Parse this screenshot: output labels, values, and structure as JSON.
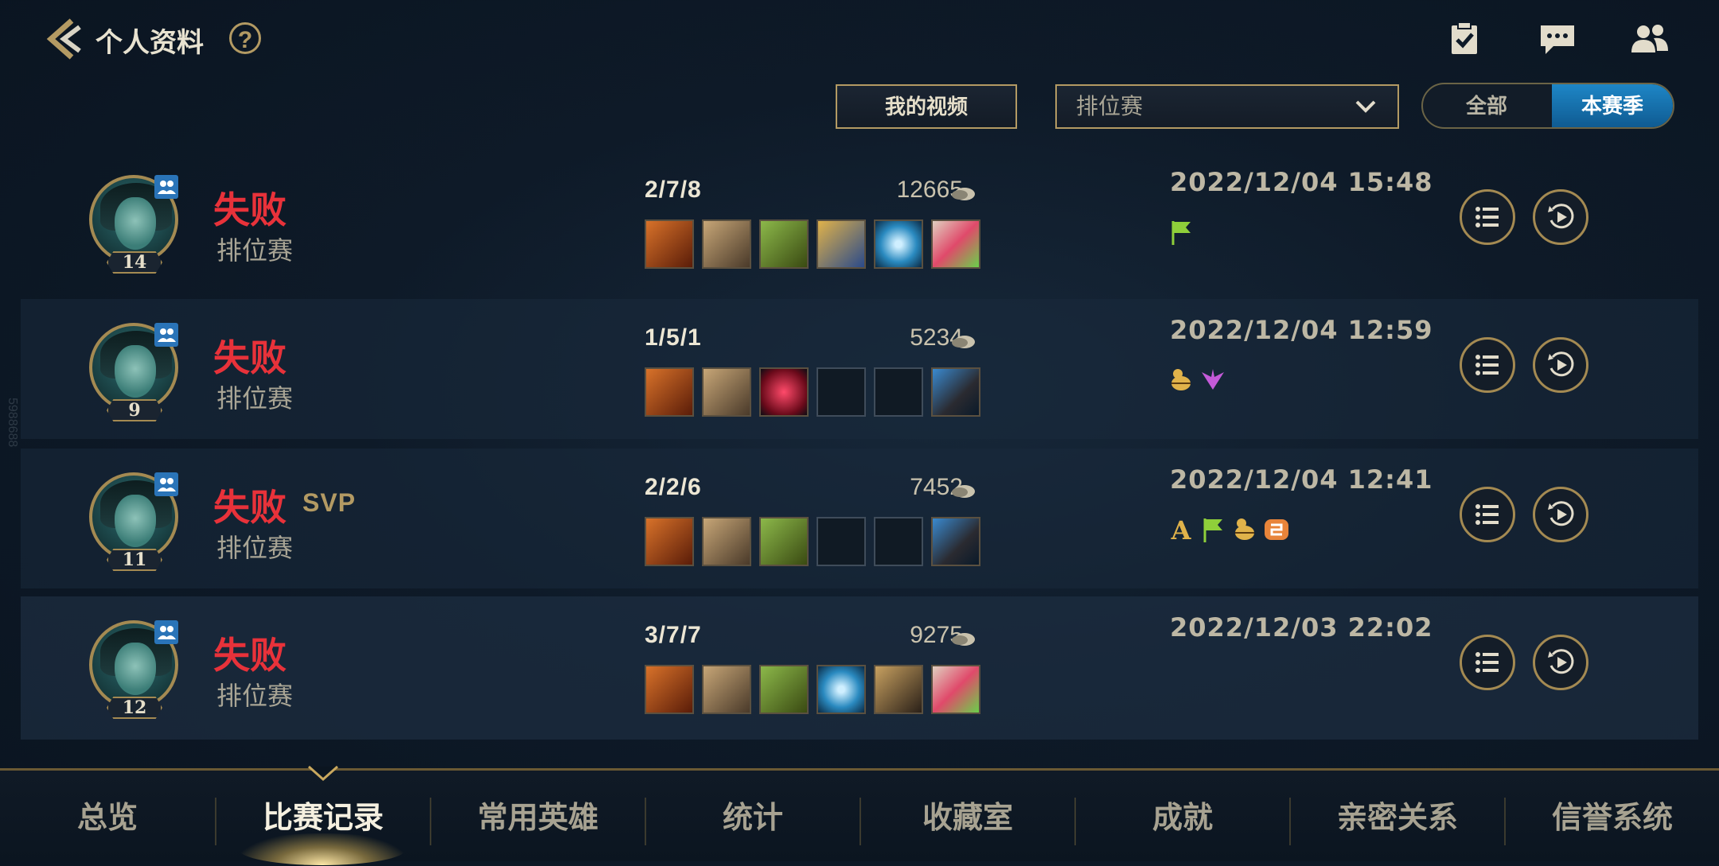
{
  "header": {
    "title": "个人资料",
    "help_label": "?"
  },
  "toolbar": {
    "video_label": "我的视频",
    "mode_value": "排位赛",
    "season_all": "全部",
    "season_current": "本赛季"
  },
  "matches": [
    {
      "level": "14",
      "result": "失败",
      "svp": "",
      "mode": "排位赛",
      "kda": "2/7/8",
      "gold": "12665",
      "datetime": "2022/12/04 15:48",
      "badges": [
        "flag-icon"
      ]
    },
    {
      "level": "9",
      "result": "失败",
      "svp": "",
      "mode": "排位赛",
      "kda": "1/5/1",
      "gold": "5234",
      "datetime": "2022/12/04 12:59",
      "badges": [
        "beetle-icon",
        "wings-icon"
      ]
    },
    {
      "level": "11",
      "result": "失败",
      "svp": "SVP",
      "mode": "排位赛",
      "kda": "2/2/6",
      "gold": "7452",
      "datetime": "2022/12/04 12:41",
      "badges": [
        "a-rank-icon",
        "flag-icon",
        "beetle-icon",
        "orange-badge-icon"
      ]
    },
    {
      "level": "12",
      "result": "失败",
      "svp": "",
      "mode": "排位赛",
      "kda": "3/7/7",
      "gold": "9275",
      "datetime": "2022/12/03 22:02",
      "badges": []
    }
  ],
  "watermark": "5988688",
  "nav": {
    "tabs": [
      "总览",
      "比赛记录",
      "常用英雄",
      "统计",
      "收藏室",
      "成就",
      "亲密关系",
      "信誉系统"
    ],
    "active_index": 1
  },
  "colors": {
    "defeat": "#e8323a",
    "accent_gold": "#b39a63",
    "active_blue": "#1e86c6"
  }
}
